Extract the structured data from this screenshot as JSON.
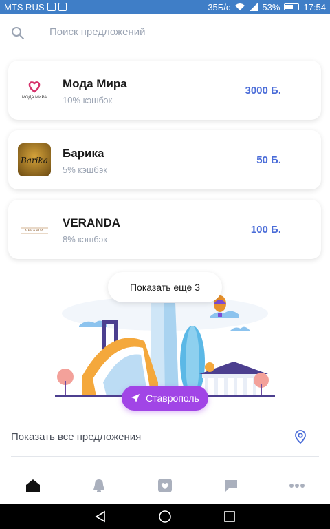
{
  "status_bar": {
    "carrier": "MTS RUS",
    "speed": "35Б/с",
    "battery": "53%",
    "time": "17:54"
  },
  "search": {
    "placeholder": "Поиск предложений"
  },
  "offers": [
    {
      "name": "Мода Мира",
      "cashback": "10% кэшбэк",
      "points": "3000 Б.",
      "logo_text": "МОДА МИРА"
    },
    {
      "name": "Барика",
      "cashback": "5% кэшбэк",
      "points": "50 Б.",
      "logo_text": "Barika"
    },
    {
      "name": "VERANDA",
      "cashback": "8% кэшбэк",
      "points": "100 Б.",
      "logo_text": "VERANDA"
    }
  ],
  "show_more": "Показать еще 3",
  "city": "Ставрополь",
  "all_offers": "Показать все предложения",
  "colors": {
    "accent": "#4a6cd8",
    "city_button": "#a145e6",
    "status_bar": "#3f7ec7"
  },
  "nav_icons": [
    "home-icon",
    "bell-icon",
    "heart-icon",
    "chat-icon",
    "more-icon"
  ]
}
